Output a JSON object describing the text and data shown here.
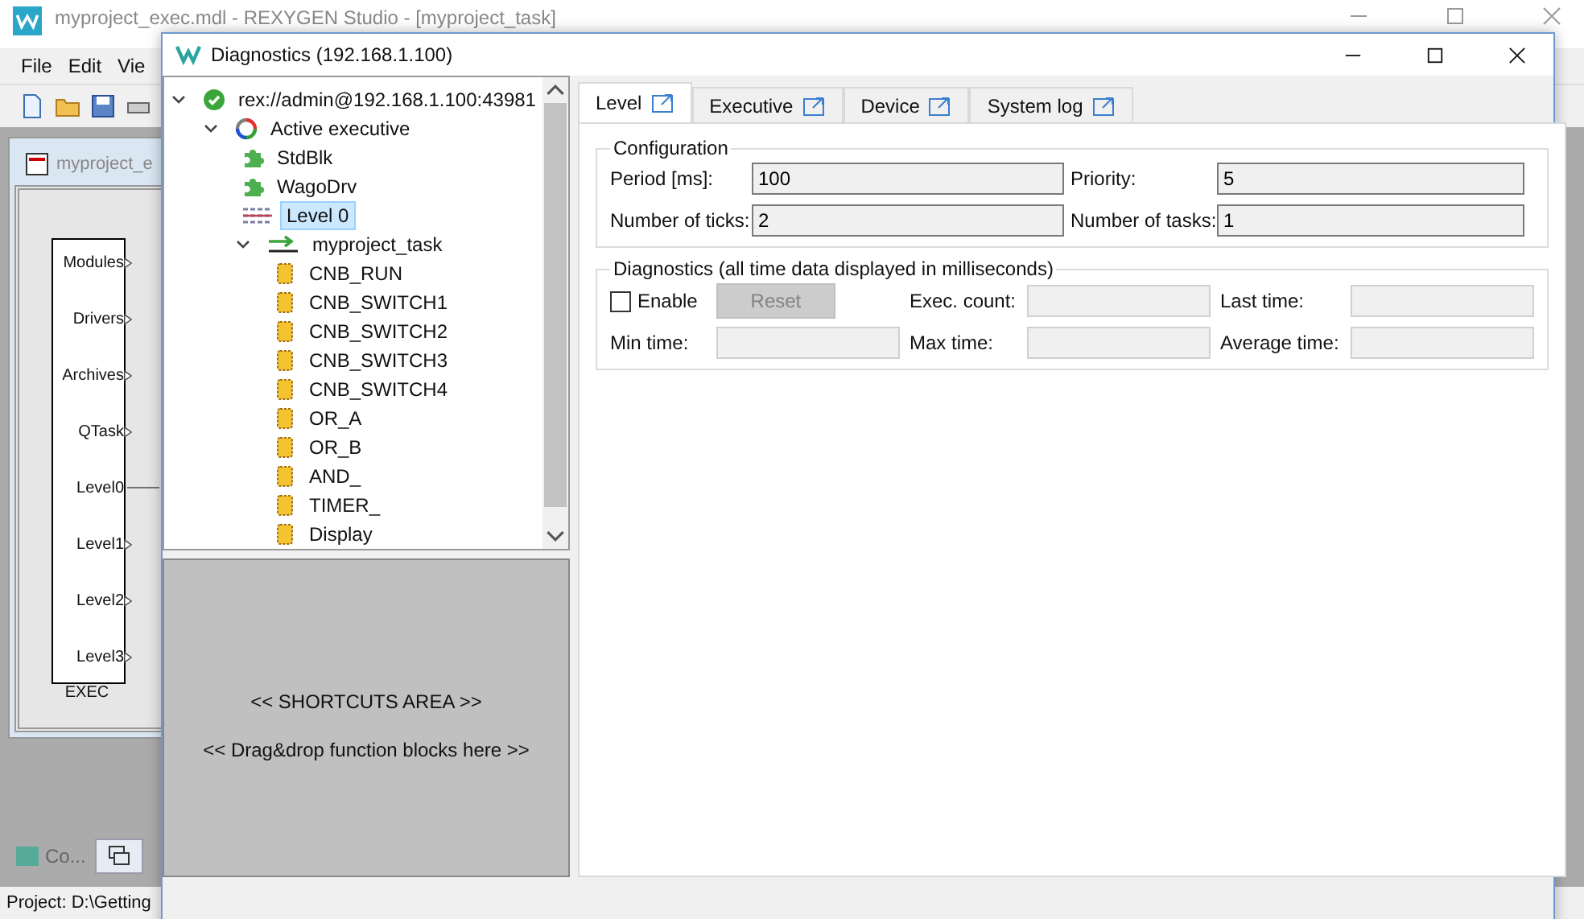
{
  "app": {
    "title": "myproject_exec.mdl - REXYGEN Studio - [myproject_task]",
    "menu": [
      "File",
      "Edit",
      "Vie"
    ],
    "document": {
      "title": "myproject_e",
      "block": {
        "name": "EXEC",
        "ports": [
          {
            "label": "Modules",
            "connected": false
          },
          {
            "label": "Drivers",
            "connected": false
          },
          {
            "label": "Archives",
            "connected": false
          },
          {
            "label": "QTask",
            "connected": false
          },
          {
            "label": "Level0",
            "connected": true
          },
          {
            "label": "Level1",
            "connected": false
          },
          {
            "label": "Level2",
            "connected": false
          },
          {
            "label": "Level3",
            "connected": false
          }
        ]
      }
    },
    "bottom_tab": "Co...",
    "status_bar": "Project: D:\\Getting"
  },
  "dialog": {
    "title": "Diagnostics (192.168.1.100)",
    "tree": [
      {
        "label": "rex://admin@192.168.1.100:43981",
        "kind": "connection",
        "selected": false,
        "expanded": true,
        "children": [
          {
            "label": "Active executive",
            "kind": "executive",
            "selected": false,
            "expanded": true,
            "children": [
              {
                "label": "StdBlk",
                "kind": "module",
                "selected": false
              },
              {
                "label": "WagoDrv",
                "kind": "module",
                "selected": false
              },
              {
                "label": "Level 0",
                "kind": "level",
                "selected": true
              },
              {
                "label": "myproject_task",
                "kind": "task",
                "selected": false,
                "expanded": true,
                "children": [
                  {
                    "label": "CNB_RUN",
                    "kind": "block",
                    "selected": false
                  },
                  {
                    "label": "CNB_SWITCH1",
                    "kind": "block",
                    "selected": false
                  },
                  {
                    "label": "CNB_SWITCH2",
                    "kind": "block",
                    "selected": false
                  },
                  {
                    "label": "CNB_SWITCH3",
                    "kind": "block",
                    "selected": false
                  },
                  {
                    "label": "CNB_SWITCH4",
                    "kind": "block",
                    "selected": false
                  },
                  {
                    "label": "OR_A",
                    "kind": "block",
                    "selected": false
                  },
                  {
                    "label": "OR_B",
                    "kind": "block",
                    "selected": false
                  },
                  {
                    "label": "AND_",
                    "kind": "block",
                    "selected": false
                  },
                  {
                    "label": "TIMER_",
                    "kind": "block",
                    "selected": false
                  },
                  {
                    "label": "Display",
                    "kind": "block",
                    "selected": false
                  }
                ]
              }
            ]
          }
        ]
      }
    ],
    "shortcuts": [
      "<< SHORTCUTS AREA >>",
      "<< Drag&drop function blocks here >>"
    ],
    "tabs": [
      {
        "label": "Level",
        "selected": true
      },
      {
        "label": "Executive",
        "selected": false
      },
      {
        "label": "Device",
        "selected": false
      },
      {
        "label": "System log",
        "selected": false
      }
    ],
    "configuration": {
      "title": "Configuration",
      "fields": [
        {
          "label": "Period [ms]:",
          "value": "100"
        },
        {
          "label": "Priority:",
          "value": "5"
        },
        {
          "label": "Number of ticks:",
          "value": "2"
        },
        {
          "label": "Number of tasks:",
          "value": "1"
        }
      ]
    },
    "diagnostics": {
      "title": "Diagnostics (all time data displayed in milliseconds)",
      "enable": {
        "label": "Enable",
        "checked": false
      },
      "reset": {
        "label": "Reset",
        "disabled": true
      },
      "fields": [
        {
          "label": "Exec. count:"
        },
        {
          "label": "Last time:"
        },
        {
          "label": "Min time:"
        },
        {
          "label": "Max time:"
        },
        {
          "label": "Average time:"
        }
      ]
    }
  }
}
